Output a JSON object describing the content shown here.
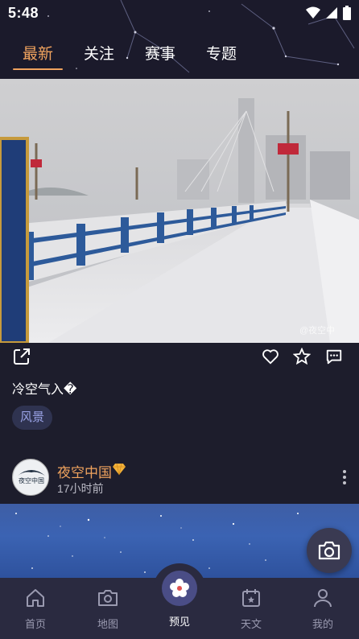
{
  "status_bar": {
    "time": "5:48"
  },
  "tabs": [
    {
      "label": "最新",
      "active": true
    },
    {
      "label": "关注",
      "active": false
    },
    {
      "label": "赛事",
      "active": false
    },
    {
      "label": "专题",
      "active": false
    }
  ],
  "post": {
    "caption": "冷空气入�",
    "tag": "风景",
    "watermark": "@夜空中"
  },
  "author": {
    "name": "夜空中国",
    "time_ago": "17小时前",
    "badge_icon": "diamond-icon",
    "avatar_text": "夜空中国"
  },
  "bottom_nav": [
    {
      "label": "首页",
      "icon": "home-icon"
    },
    {
      "label": "地图",
      "icon": "camera-map-icon"
    },
    {
      "label": "预见",
      "icon": "flower-icon",
      "active": true
    },
    {
      "label": "天文",
      "icon": "calendar-star-icon"
    },
    {
      "label": "我的",
      "icon": "person-icon"
    }
  ],
  "colors": {
    "accent": "#f0a35e",
    "background": "#1d1d2c",
    "tag_text": "#9aa3e6",
    "nav_bg": "#2a2a40"
  }
}
